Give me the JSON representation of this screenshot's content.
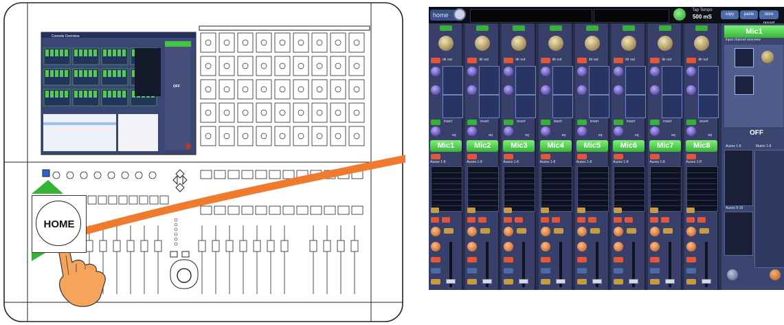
{
  "left_illustration": {
    "home_key_label": "HOME",
    "mini_screen_title": "Console Overview",
    "mini_off_label": "OFF"
  },
  "screen": {
    "home_tab": "home",
    "tap_tempo_label": "Tap Tempo",
    "tap_tempo_value": "500 mS",
    "buttons": [
      "copy",
      "paste",
      "store preset"
    ],
    "channels": [
      "Mic1",
      "Mic2",
      "Mic3",
      "Mic4",
      "Mic5",
      "Mic6",
      "Mic7",
      "Mic8"
    ],
    "channel_label_insert": "insert",
    "channel_label_eq": "eq",
    "channel_label_dirout": "dir out",
    "bus_title": "Auxes 1-8",
    "selected_channel": "Mic1",
    "selected_label": "input channel overview",
    "status": "OFF",
    "right_bus_auxes": "Auxes 1-8",
    "right_bus_matrix": "Matrix 1-8",
    "right_bus_auxes2": "Auxes 9-16"
  },
  "colors": {
    "arrow": "#f07a2e",
    "channel_green": "#4fcf4a",
    "screen_bg": "#2a3052",
    "hand_fill": "#f6a45c"
  }
}
